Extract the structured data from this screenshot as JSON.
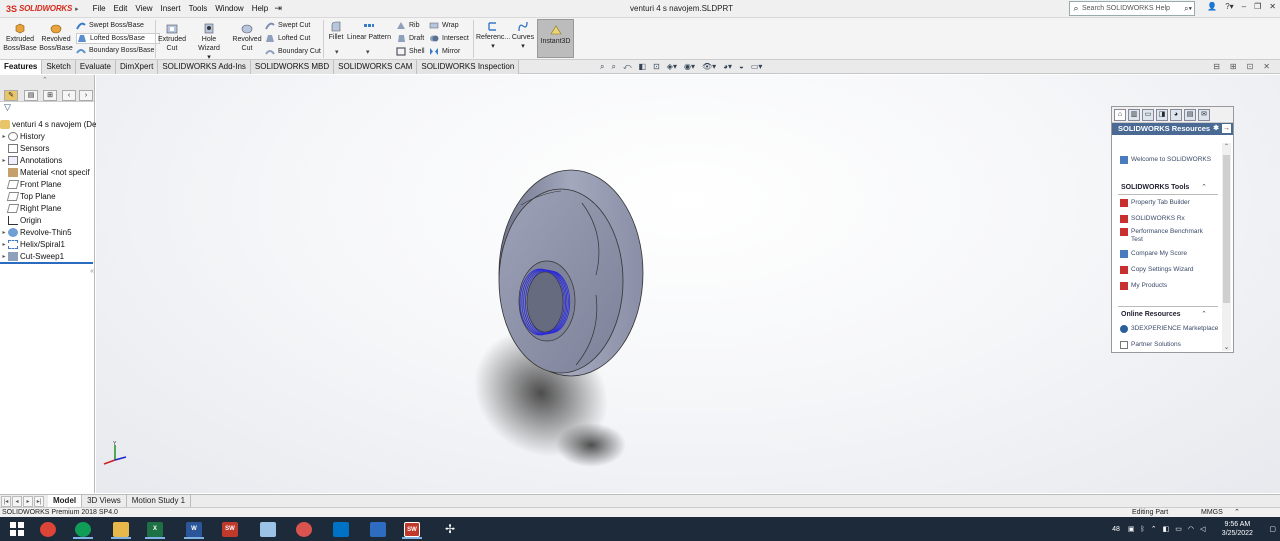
{
  "app": {
    "logo_prefix": "3S",
    "logo_text": "SOLIDWORKS",
    "doc_title": "venturi 4 s navojem.SLDPRT"
  },
  "menu": [
    "File",
    "Edit",
    "View",
    "Insert",
    "Tools",
    "Window",
    "Help"
  ],
  "search": {
    "placeholder": "Search SOLIDWORKS Help"
  },
  "cmd": {
    "extruded_boss": "Extruded Boss/Base",
    "revolved_boss": "Revolved Boss/Base",
    "swept_boss": "Swept Boss/Base",
    "lofted_boss": "Lofted Boss/Base",
    "boundary_boss": "Boundary Boss/Base",
    "extruded_cut": "Extruded Cut",
    "hole_wizard": "Hole Wizard",
    "revolved_cut": "Revolved Cut",
    "swept_cut": "Swept Cut",
    "lofted_cut": "Lofted Cut",
    "boundary_cut": "Boundary Cut",
    "fillet": "Fillet",
    "linear_pattern": "Linear Pattern",
    "rib": "Rib",
    "draft": "Draft",
    "shell": "Shell",
    "wrap": "Wrap",
    "intersect": "Intersect",
    "mirror": "Mirror",
    "reference": "Referenc...",
    "curves": "Curves",
    "instant3d": "Instant3D"
  },
  "tabs": [
    "Features",
    "Sketch",
    "Evaluate",
    "DimXpert",
    "SOLIDWORKS Add-Ins",
    "SOLIDWORKS MBD",
    "SOLIDWORKS CAM",
    "SOLIDWORKS Inspection"
  ],
  "tree": {
    "root": "venturi 4 s navojem  (De",
    "items": [
      "History",
      "Sensors",
      "Annotations",
      "Material <not specif",
      "Front Plane",
      "Top Plane",
      "Right Plane",
      "Origin",
      "Revolve-Thin5",
      "Helix/Spiral1",
      "Cut-Sweep1"
    ]
  },
  "taskpane": {
    "title": "SOLIDWORKS Resources",
    "welcome": "Welcome to SOLIDWORKS",
    "tools_heading": "SOLIDWORKS Tools",
    "tools": [
      "Property Tab Builder",
      "SOLIDWORKS Rx",
      "Performance Benchmark Test",
      "Compare My Score",
      "Copy Settings Wizard",
      "My Products"
    ],
    "online_heading": "Online Resources",
    "online": [
      "3DEXPERIENCE Marketplace",
      "Partner Solutions"
    ]
  },
  "bottom_tabs": [
    "Model",
    "3D Views",
    "Motion Study 1"
  ],
  "status": {
    "version": "SOLIDWORKS Premium 2018 SP4.0",
    "mode": "Editing Part",
    "units": "MMGS"
  },
  "taskbar": {
    "time": "9:56 AM",
    "date": "3/25/2022",
    "badge": "48"
  },
  "colors": {
    "accent": "#d52b1e",
    "tree_rollback": "#2a6bbf",
    "taskpane_header": "#4a6a94",
    "part_body": "#8e93ab",
    "thread": "#2b2bd6"
  }
}
